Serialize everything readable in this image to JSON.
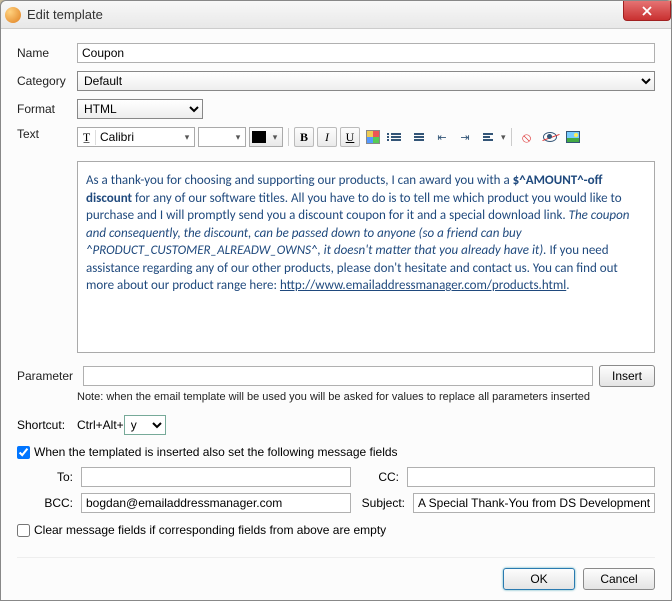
{
  "title": "Edit template",
  "labels": {
    "name": "Name",
    "category": "Category",
    "format": "Format",
    "text": "Text",
    "parameter": "Parameter",
    "shortcut_prefix": "Shortcut:",
    "shortcut_mod": "Ctrl+Alt+",
    "to": "To:",
    "cc": "CC:",
    "bcc": "BCC:",
    "subject": "Subject:"
  },
  "values": {
    "name": "Coupon",
    "category": "Default",
    "format": "HTML",
    "font_name": "Calibri",
    "font_size": "",
    "parameter": "",
    "shortcut_key": "y",
    "to": "",
    "cc": "",
    "bcc": "bogdan@emailaddressmanager.com",
    "subject": "A Special Thank-You from DS Development"
  },
  "editor": {
    "t1": "As a thank-you for choosing and supporting our products, I can award you with a ",
    "t2": "$^AMOUNT^-off discount",
    "t3": " for any of our software titles. All you have to do is to tell me which product you would like to purchase and I will promptly send you a discount coupon for it and a special download link. ",
    "t4": "The coupon and consequently, the discount, can be passed down to anyone (so a friend can buy ^PRODUCT_CUSTOMER_ALREADW_OWNS^, it doesn't matter that you already have it).",
    "t5": " If you need assistance regarding any of our other products, please don't hesitate and contact us. You can find out more about our product range here: ",
    "link": "http://www.emailaddressmanager.com/products.html",
    "t6": "."
  },
  "buttons": {
    "insert": "Insert",
    "ok": "OK",
    "cancel": "Cancel"
  },
  "checks": {
    "set_fields": "When the templated is inserted also set the following message fields",
    "clear_fields": "Clear message fields if corresponding fields from above are empty"
  },
  "note": "Note: when the email template will be used you will be asked for values to replace all parameters inserted",
  "format_btns": {
    "bold": "B",
    "italic": "I",
    "underline": "U"
  }
}
